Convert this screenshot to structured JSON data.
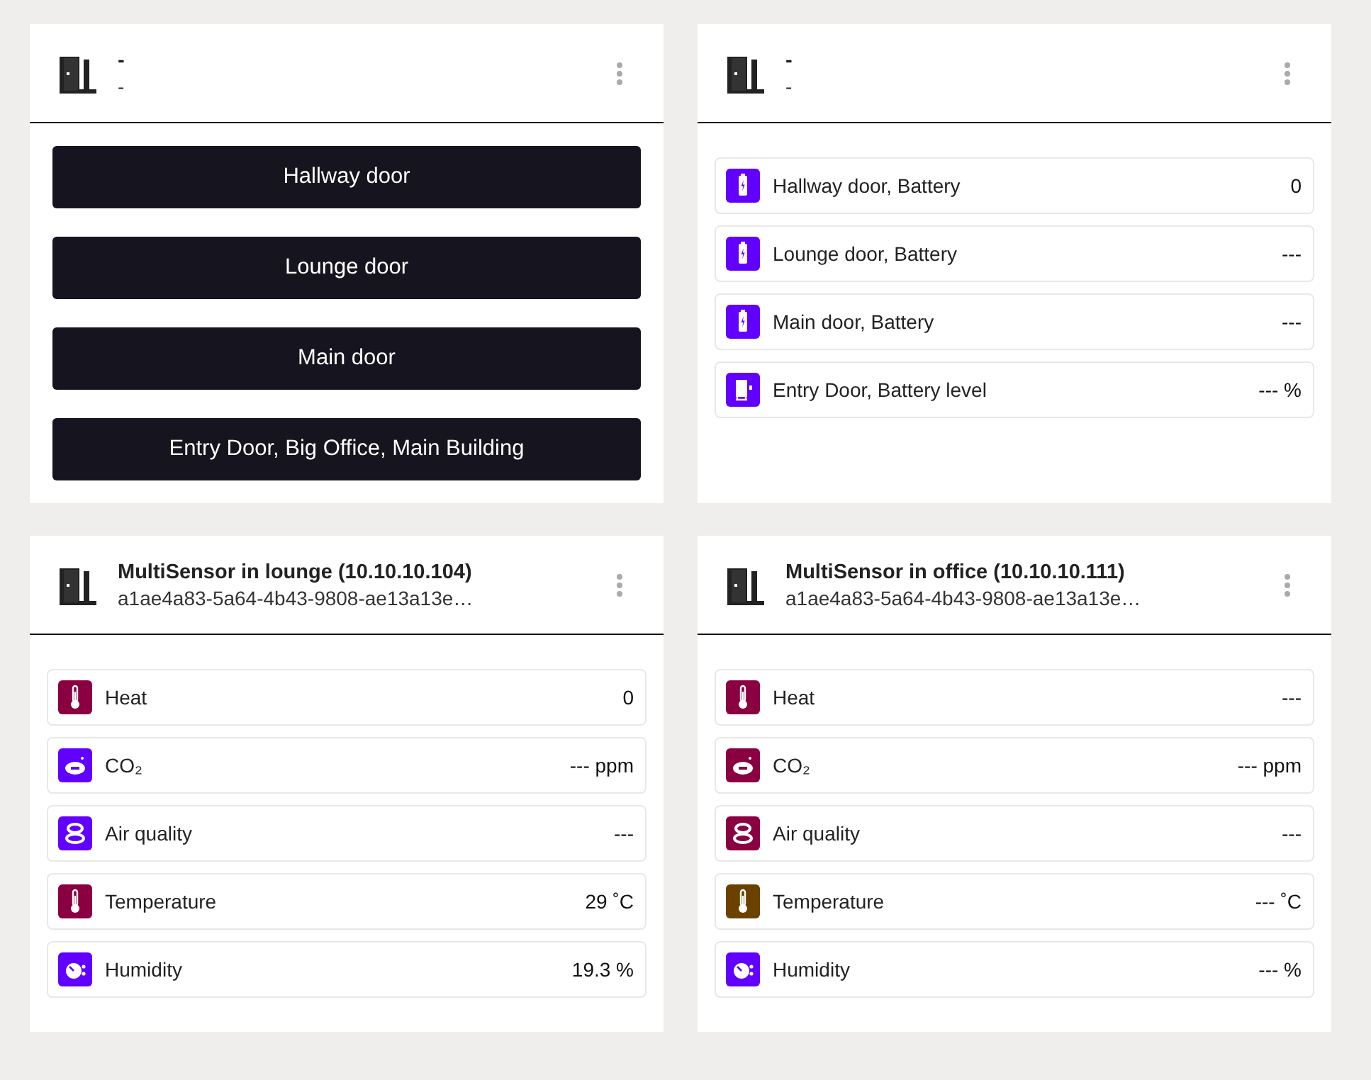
{
  "cards": [
    {
      "title": "-",
      "subtitle": "-",
      "kind": "buttons",
      "buttons": [
        "Hallway door",
        "Lounge door",
        "Main door",
        "Entry Door, Big Office, Main Building"
      ]
    },
    {
      "title": "-",
      "subtitle": "-",
      "kind": "sensors",
      "sensors": [
        {
          "kind": "battery",
          "color": "#6200ff",
          "label": "Hallway door, Battery",
          "value": "0"
        },
        {
          "kind": "battery",
          "color": "#6200ff",
          "label": "Lounge door, Battery",
          "value": "---"
        },
        {
          "kind": "battery",
          "color": "#6200ff",
          "label": "Main door, Battery",
          "value": "---"
        },
        {
          "kind": "charger",
          "color": "#6200ff",
          "label": "Entry Door, Battery level",
          "value": "--- %"
        }
      ]
    },
    {
      "title": "MultiSensor in lounge (10.10.10.104)",
      "subtitle": "a1ae4a83-5a64-4b43-9808-ae13a13e…",
      "kind": "sensors",
      "sensors": [
        {
          "kind": "thermometer",
          "color": "#8a0040",
          "label": "Heat",
          "value": "0"
        },
        {
          "kind": "co2",
          "color": "#6200ff",
          "label": "CO₂",
          "value": "--- ppm"
        },
        {
          "kind": "air",
          "color": "#6200ff",
          "label": "Air quality",
          "value": "---"
        },
        {
          "kind": "thermometer",
          "color": "#8a0040",
          "label": "Temperature",
          "value": "29 ˚C"
        },
        {
          "kind": "humidity",
          "color": "#6200ff",
          "label": "Humidity",
          "value": "19.3 %"
        }
      ]
    },
    {
      "title": "MultiSensor in office (10.10.10.111)",
      "subtitle": "a1ae4a83-5a64-4b43-9808-ae13a13e…",
      "kind": "sensors",
      "sensors": [
        {
          "kind": "thermometer",
          "color": "#8a0040",
          "label": "Heat",
          "value": "---"
        },
        {
          "kind": "co2",
          "color": "#8a0040",
          "label": "CO₂",
          "value": "--- ppm"
        },
        {
          "kind": "air",
          "color": "#8a0040",
          "label": "Air quality",
          "value": "---"
        },
        {
          "kind": "thermometer",
          "color": "#6b4100",
          "label": "Temperature",
          "value": "--- ˚C"
        },
        {
          "kind": "humidity",
          "color": "#6200ff",
          "label": "Humidity",
          "value": "--- %"
        }
      ]
    }
  ]
}
